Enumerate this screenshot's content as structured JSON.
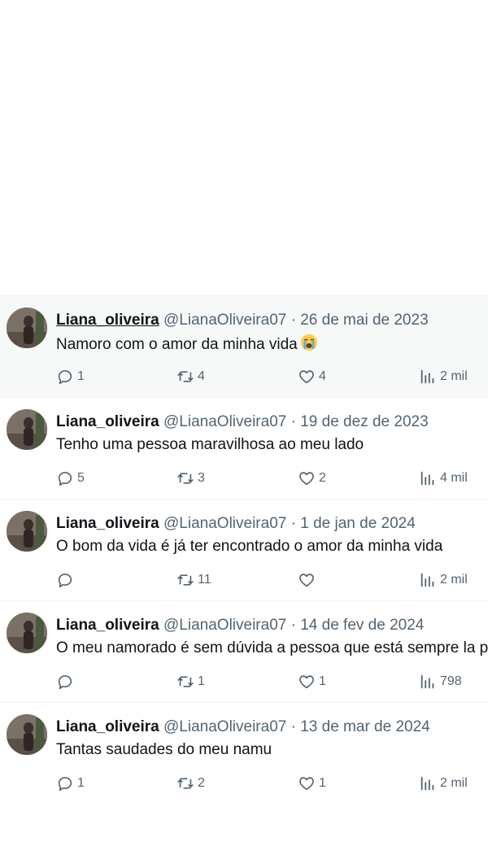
{
  "tweets": [
    {
      "name": "Liana_oliveira",
      "handle": "@LianaOliveira07",
      "separator": "·",
      "date": "26 de mai de 2023",
      "text": "Namoro com o amor da minha vida",
      "emoji": "loudly-crying-face",
      "replies": "1",
      "retweets": "4",
      "likes": "4",
      "views": "2 mil"
    },
    {
      "name": "Liana_oliveira",
      "handle": "@LianaOliveira07",
      "separator": "·",
      "date": "19 de dez de 2023",
      "text": "Tenho uma pessoa maravilhosa ao meu lado",
      "replies": "5",
      "retweets": "3",
      "likes": "2",
      "views": "4 mil"
    },
    {
      "name": "Liana_oliveira",
      "handle": "@LianaOliveira07",
      "separator": "·",
      "date": "1 de jan de 2024",
      "text": "O bom da vida é já ter encontrado o amor da minha vida",
      "replies": "",
      "retweets": "11",
      "likes": "",
      "views": "2 mil"
    },
    {
      "name": "Liana_oliveira",
      "handle": "@LianaOliveira07",
      "separator": "·",
      "date": "14 de fev de 2024",
      "text": "O meu namorado é sem dúvida a pessoa que está sempre la p",
      "replies": "",
      "retweets": "1",
      "likes": "1",
      "views": "798"
    },
    {
      "name": "Liana_oliveira",
      "handle": "@LianaOliveira07",
      "separator": "·",
      "date": "13 de mar de 2024",
      "text": "Tantas saudades do meu namu",
      "replies": "1",
      "retweets": "2",
      "likes": "1",
      "views": "2 mil"
    }
  ],
  "colors": {
    "primary_text": "#0f1419",
    "secondary_text": "#536471",
    "divider": "#eff3f4",
    "highlight_bg": "#f7f9f9"
  },
  "icons": {
    "reply": "reply-icon",
    "retweet": "retweet-icon",
    "like": "heart-icon",
    "views": "views-icon"
  }
}
